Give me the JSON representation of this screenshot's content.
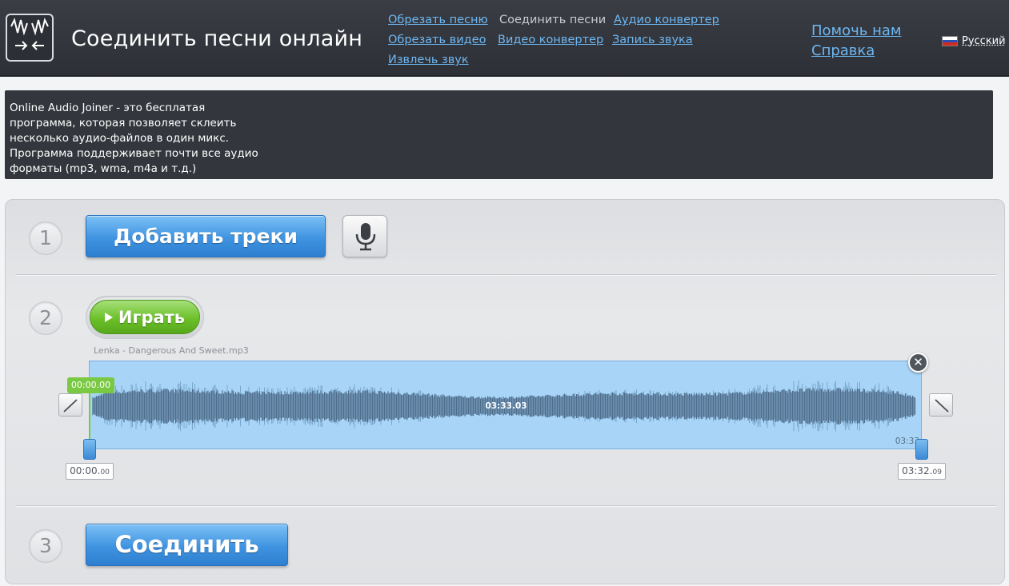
{
  "header": {
    "title": "Соединить песни онлайн",
    "nav": {
      "cut_song": "Обрезать песню",
      "join_songs": "Соединить песни",
      "audio_converter": "Аудио конвертер",
      "cut_video": "Обрезать видео",
      "video_converter": "Видео конвертер",
      "record_sound": "Запись звука",
      "extract_sound": "Извлечь звук"
    },
    "help_us": "Помочь нам",
    "help": "Справка",
    "language": "Русский"
  },
  "info": {
    "text": "Online Audio Joiner - это бесплатая программа, которая позволяет склеить несколько аудио-файлов в один микс. Программа поддерживает почти все аудио форматы (mp3, wma, m4a и т.д.)"
  },
  "steps": {
    "step1": {
      "number": "1",
      "add_tracks": "Добавить треки"
    },
    "step2": {
      "number": "2",
      "play": "Играть",
      "track": {
        "filename": "Lenka - Dangerous And Sweet.mp3",
        "duration": "03:33.03",
        "end_label": "03:33",
        "playhead_time": "00:00.00",
        "start_time_main": "00:00.",
        "start_time_ms": "00",
        "end_time_main": "03:32.",
        "end_time_ms": "09"
      }
    },
    "step3": {
      "number": "3",
      "join": "Соединить"
    }
  },
  "colors": {
    "header_bg": "#2d3036",
    "link": "#6db7f2",
    "waveform_bg": "#a7d4f7",
    "waveform_fg": "#4f6e8c",
    "play_green": "#6cc02a",
    "action_blue": "#3f93e0"
  },
  "icons": {
    "logo": "waveform-logo-icon",
    "microphone": "microphone-icon",
    "play": "play-icon",
    "close": "close-icon",
    "fade_in": "fade-in-icon",
    "fade_out": "fade-out-icon",
    "flag": "russia-flag-icon"
  }
}
